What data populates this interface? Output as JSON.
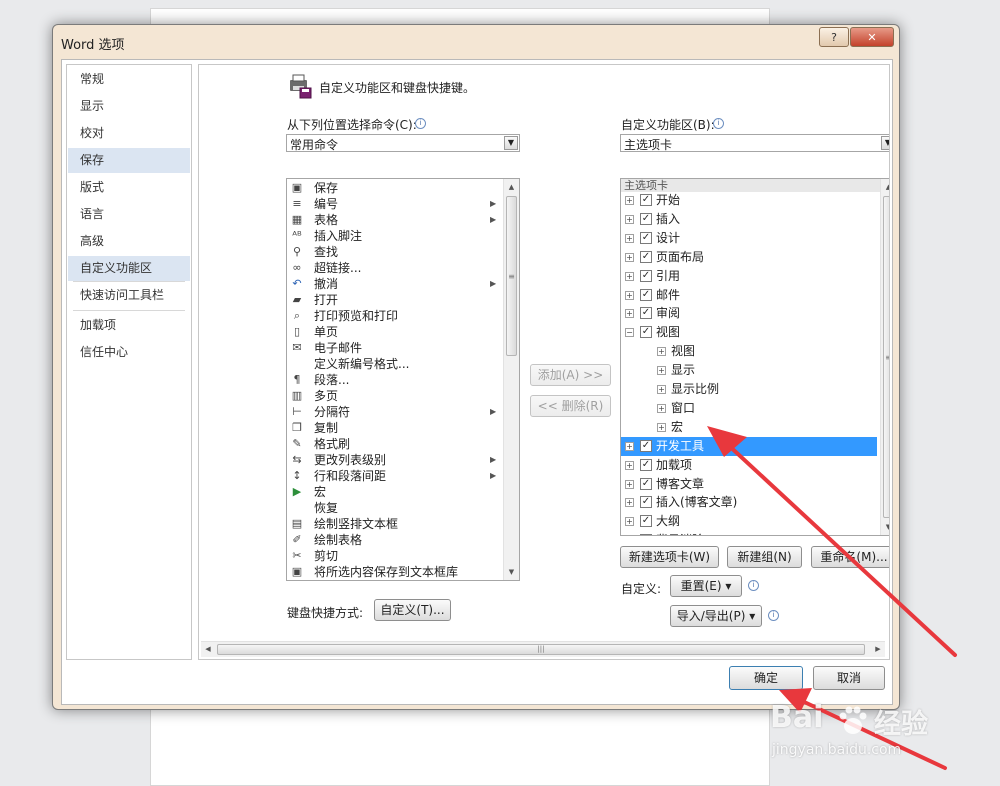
{
  "dialog": {
    "title": "Word 选项",
    "help_label": "?",
    "close_label": "✕"
  },
  "nav": [
    {
      "label": "常规"
    },
    {
      "label": "显示"
    },
    {
      "label": "校对"
    },
    {
      "label": "保存"
    },
    {
      "label": "版式"
    },
    {
      "label": "语言"
    },
    {
      "label": "高级"
    },
    {
      "label": "自定义功能区"
    },
    {
      "label": "快速访问工具栏"
    },
    {
      "label": "加载项"
    },
    {
      "label": "信任中心"
    }
  ],
  "header": {
    "text": "自定义功能区和键盘快捷键。",
    "icon": "ribbon-customize-icon"
  },
  "left": {
    "label": "从下列位置选择命令(C):",
    "combo_value": "常用命令",
    "commands": [
      {
        "icon": "save-icon",
        "label": "保存",
        "submenu": false
      },
      {
        "icon": "numbering-icon",
        "label": "编号",
        "submenu": true
      },
      {
        "icon": "table-icon",
        "label": "表格",
        "submenu": true
      },
      {
        "icon": "footnote-icon",
        "label": "插入脚注",
        "submenu": false
      },
      {
        "icon": "find-icon",
        "label": "查找",
        "submenu": false
      },
      {
        "icon": "hyperlink-icon",
        "label": "超链接...",
        "submenu": false
      },
      {
        "icon": "undo-icon",
        "label": "撤消",
        "submenu": true
      },
      {
        "icon": "open-icon",
        "label": "打开",
        "submenu": false
      },
      {
        "icon": "print-preview-icon",
        "label": "打印预览和打印",
        "submenu": false
      },
      {
        "icon": "single-page-icon",
        "label": "单页",
        "submenu": false
      },
      {
        "icon": "email-icon",
        "label": "电子邮件",
        "submenu": false
      },
      {
        "icon": "",
        "label": "定义新编号格式...",
        "submenu": false
      },
      {
        "icon": "paragraph-icon",
        "label": "段落...",
        "submenu": false
      },
      {
        "icon": "multi-page-icon",
        "label": "多页",
        "submenu": false
      },
      {
        "icon": "break-icon",
        "label": "分隔符",
        "submenu": true
      },
      {
        "icon": "copy-icon",
        "label": "复制",
        "submenu": false
      },
      {
        "icon": "format-painter-icon",
        "label": "格式刷",
        "submenu": false
      },
      {
        "icon": "list-level-icon",
        "label": "更改列表级别",
        "submenu": true
      },
      {
        "icon": "line-spacing-icon",
        "label": "行和段落间距",
        "submenu": true
      },
      {
        "icon": "macro-icon",
        "label": "宏",
        "submenu": false
      },
      {
        "icon": "",
        "label": "恢复",
        "submenu": false
      },
      {
        "icon": "vertical-textbox-icon",
        "label": "绘制竖排文本框",
        "submenu": false
      },
      {
        "icon": "draw-table-icon",
        "label": "绘制表格",
        "submenu": false
      },
      {
        "icon": "cut-icon",
        "label": "剪切",
        "submenu": false
      },
      {
        "icon": "save-selection-icon",
        "label": "将所选内容保存到文本框库",
        "submenu": false
      }
    ]
  },
  "middle": {
    "add_label": "添加(A) >>",
    "remove_label": "<< 删除(R)"
  },
  "right": {
    "label": "自定义功能区(B):",
    "combo_value": "主选项卡",
    "tree_header": "主选项卡",
    "tree": [
      {
        "level": 0,
        "expander": "+",
        "checked": true,
        "label": "开始"
      },
      {
        "level": 0,
        "expander": "+",
        "checked": true,
        "label": "插入"
      },
      {
        "level": 0,
        "expander": "+",
        "checked": true,
        "label": "设计"
      },
      {
        "level": 0,
        "expander": "+",
        "checked": true,
        "label": "页面布局"
      },
      {
        "level": 0,
        "expander": "+",
        "checked": true,
        "label": "引用"
      },
      {
        "level": 0,
        "expander": "+",
        "checked": true,
        "label": "邮件"
      },
      {
        "level": 0,
        "expander": "+",
        "checked": true,
        "label": "审阅"
      },
      {
        "level": 0,
        "expander": "−",
        "checked": true,
        "label": "视图"
      },
      {
        "level": 1,
        "expander": "+",
        "label": "视图"
      },
      {
        "level": 1,
        "expander": "+",
        "label": "显示"
      },
      {
        "level": 1,
        "expander": "+",
        "label": "显示比例"
      },
      {
        "level": 1,
        "expander": "+",
        "label": "窗口"
      },
      {
        "level": 1,
        "expander": "+",
        "label": "宏"
      },
      {
        "level": 0,
        "expander": "+",
        "checked": true,
        "label": "开发工具",
        "selected": true
      },
      {
        "level": 0,
        "expander": "+",
        "checked": true,
        "label": "加载项"
      },
      {
        "level": 0,
        "expander": "+",
        "checked": true,
        "label": "博客文章"
      },
      {
        "level": 0,
        "expander": "+",
        "checked": true,
        "label": "插入(博客文章)"
      },
      {
        "level": 0,
        "expander": "+",
        "checked": true,
        "label": "大纲"
      },
      {
        "level": 0,
        "expander": "+",
        "checked": true,
        "label": "背景消除"
      }
    ],
    "new_tab_label": "新建选项卡(W)",
    "new_group_label": "新建组(N)",
    "rename_label": "重命名(M)...",
    "customize_label": "自定义:",
    "reset_label": "重置(E) ▾",
    "import_export_label": "导入/导出(P) ▾",
    "move_up_label": "▲",
    "move_down_label": "▼"
  },
  "keyboard": {
    "label": "键盘快捷方式:",
    "button_label": "自定义(T)..."
  },
  "footer": {
    "ok_label": "确定",
    "cancel_label": "取消"
  },
  "watermark": {
    "brand": "Bai",
    "brand2": "经验",
    "url": "jingyan.baidu.com"
  },
  "colors": {
    "selection": "#3399ff",
    "nav_selected": "#dbe5f2",
    "annotation_arrow": "#e8383d"
  }
}
